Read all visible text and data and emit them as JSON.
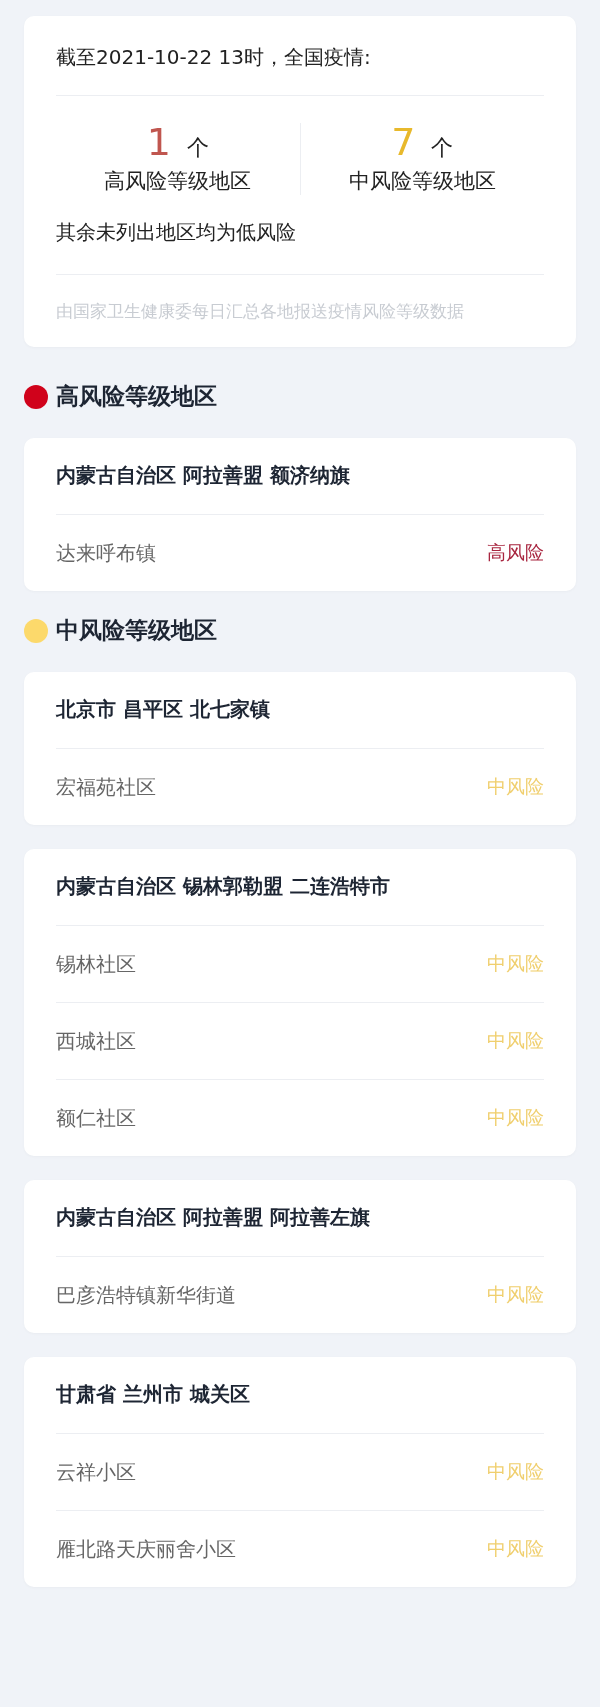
{
  "summary": {
    "headline": "截至2021-10-22 13时，全国疫情:",
    "stats": [
      {
        "kind": "high",
        "count": "1",
        "unit": "个",
        "label": "高风险等级地区"
      },
      {
        "kind": "medium",
        "count": "7",
        "unit": "个",
        "label": "中风险等级地区"
      }
    ],
    "note": "其余未列出地区均为低风险",
    "source": "由国家卫生健康委每日汇总各地报送疫情风险等级数据"
  },
  "sections": [
    {
      "kind": "high",
      "title": "高风险等级地区",
      "color": "#d0021b",
      "groups": [
        {
          "region": "内蒙古自治区 阿拉善盟 额济纳旗",
          "places": [
            {
              "name": "达来呼布镇",
              "risk": "高风险"
            }
          ]
        }
      ]
    },
    {
      "kind": "medium",
      "title": "中风险等级地区",
      "color": "#fcd96b",
      "groups": [
        {
          "region": "北京市 昌平区 北七家镇",
          "places": [
            {
              "name": "宏福苑社区",
              "risk": "中风险"
            }
          ]
        },
        {
          "region": "内蒙古自治区 锡林郭勒盟 二连浩特市",
          "places": [
            {
              "name": "锡林社区",
              "risk": "中风险"
            },
            {
              "name": "西城社区",
              "risk": "中风险"
            },
            {
              "name": "额仁社区",
              "risk": "中风险"
            }
          ]
        },
        {
          "region": "内蒙古自治区 阿拉善盟 阿拉善左旗",
          "places": [
            {
              "name": "巴彦浩特镇新华街道",
              "risk": "中风险"
            }
          ]
        },
        {
          "region": "甘肃省 兰州市 城关区",
          "places": [
            {
              "name": "云祥小区",
              "risk": "中风险"
            },
            {
              "name": "雁北路天庆丽舍小区",
              "risk": "中风险"
            }
          ]
        }
      ]
    }
  ]
}
